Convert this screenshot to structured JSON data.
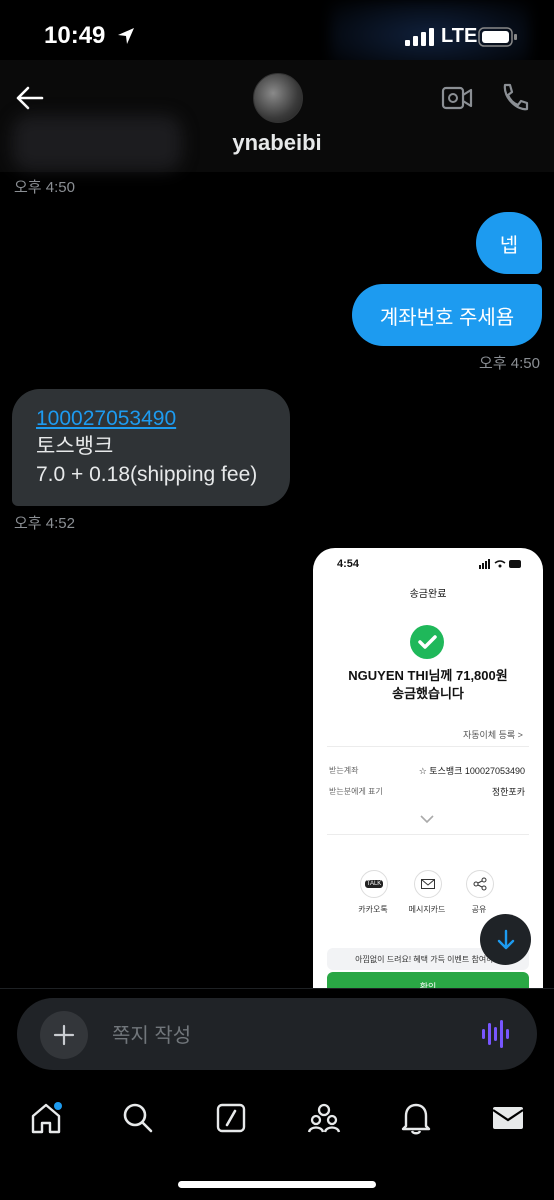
{
  "status_bar": {
    "time": "10:49",
    "network": "LTE"
  },
  "header": {
    "handle": "ynabeibi"
  },
  "messages": {
    "time_1": "오후 4:50",
    "out_1": "넵",
    "out_2": "계좌번호 주세욤",
    "time_2": "오후 4:50",
    "in_link": "100027053490",
    "in_line2": "토스뱅크",
    "in_line3": "7.0 + 0.18(shipping fee)",
    "time_3": "오후 4:52"
  },
  "attachment": {
    "time": "4:54",
    "title": "송금완료",
    "main_line1": "NGUYEN THI님께 71,800원",
    "main_line2": "송금했습니다",
    "auto_transfer": "자동이체 등록 >",
    "row1_label": "받는계좌",
    "row1_value": "☆ 토스뱅크 100027053490",
    "row2_label": "받는분에게 표기",
    "row2_value": "정한포카",
    "share": [
      {
        "label": "카카오톡",
        "icon": "kakaotalk-icon"
      },
      {
        "label": "메시지카드",
        "icon": "envelope-icon"
      },
      {
        "label": "공유",
        "icon": "share-icon"
      }
    ],
    "banner": "아낌없이 드려요! 혜택 가득 이벤트 참여하기",
    "confirm": "확인"
  },
  "composer": {
    "placeholder": "쪽지 작성"
  },
  "colors": {
    "accent": "#1d9bf0",
    "bubble_in": "#2f3336",
    "success": "#1fb85a",
    "voice": "#7856ff"
  }
}
